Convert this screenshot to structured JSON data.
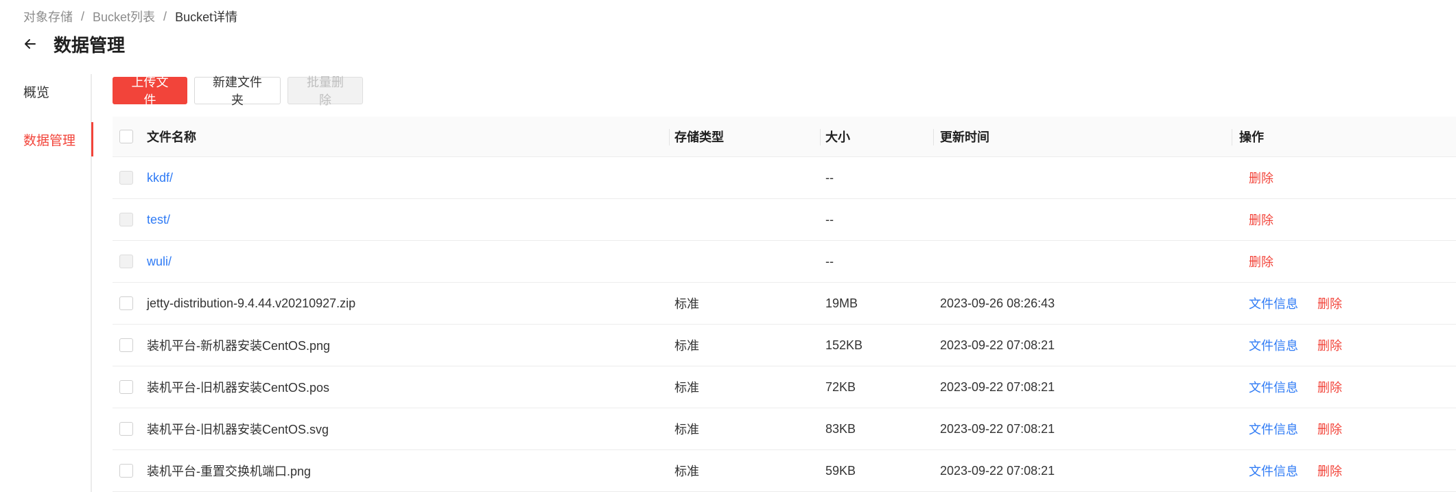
{
  "breadcrumb": {
    "items": [
      "对象存储",
      "Bucket列表",
      "Bucket详情"
    ],
    "separator": "/"
  },
  "page": {
    "title": "数据管理"
  },
  "side_nav": {
    "items": [
      {
        "label": "概览",
        "active": false
      },
      {
        "label": "数据管理",
        "active": true
      }
    ]
  },
  "toolbar": {
    "upload_label": "上传文件",
    "new_folder_label": "新建文件夹",
    "batch_delete_label": "批量删除"
  },
  "table": {
    "columns": {
      "name": "文件名称",
      "storage_type": "存储类型",
      "size": "大小",
      "updated": "更新时间",
      "ops": "操作"
    },
    "rows": [
      {
        "name": "kkdf/",
        "type": "",
        "size": "--",
        "time": "",
        "info": "",
        "del": "删除"
      },
      {
        "name": "test/",
        "type": "",
        "size": "--",
        "time": "",
        "info": "",
        "del": "删除"
      },
      {
        "name": "wuli/",
        "type": "",
        "size": "--",
        "time": "",
        "info": "",
        "del": "删除"
      },
      {
        "name": "jetty-distribution-9.4.44.v20210927.zip",
        "type": "标准",
        "size": "19MB",
        "time": "2023-09-26 08:26:43",
        "info": "文件信息",
        "del": "删除"
      },
      {
        "name": "装机平台-新机器安装CentOS.png",
        "type": "标准",
        "size": "152KB",
        "time": "2023-09-22 07:08:21",
        "info": "文件信息",
        "del": "删除"
      },
      {
        "name": "装机平台-旧机器安装CentOS.pos",
        "type": "标准",
        "size": "72KB",
        "time": "2023-09-22 07:08:21",
        "info": "文件信息",
        "del": "删除"
      },
      {
        "name": "装机平台-旧机器安装CentOS.svg",
        "type": "标准",
        "size": "83KB",
        "time": "2023-09-22 07:08:21",
        "info": "文件信息",
        "del": "删除"
      },
      {
        "name": "装机平台-重置交换机端口.png",
        "type": "标准",
        "size": "59KB",
        "time": "2023-09-22 07:08:21",
        "info": "文件信息",
        "del": "删除"
      }
    ]
  },
  "colors": {
    "accent": "#f2443a",
    "link": "#2f7bf5",
    "header_bg": "#fafafa"
  },
  "icons": {
    "back": "arrow-left-icon"
  }
}
